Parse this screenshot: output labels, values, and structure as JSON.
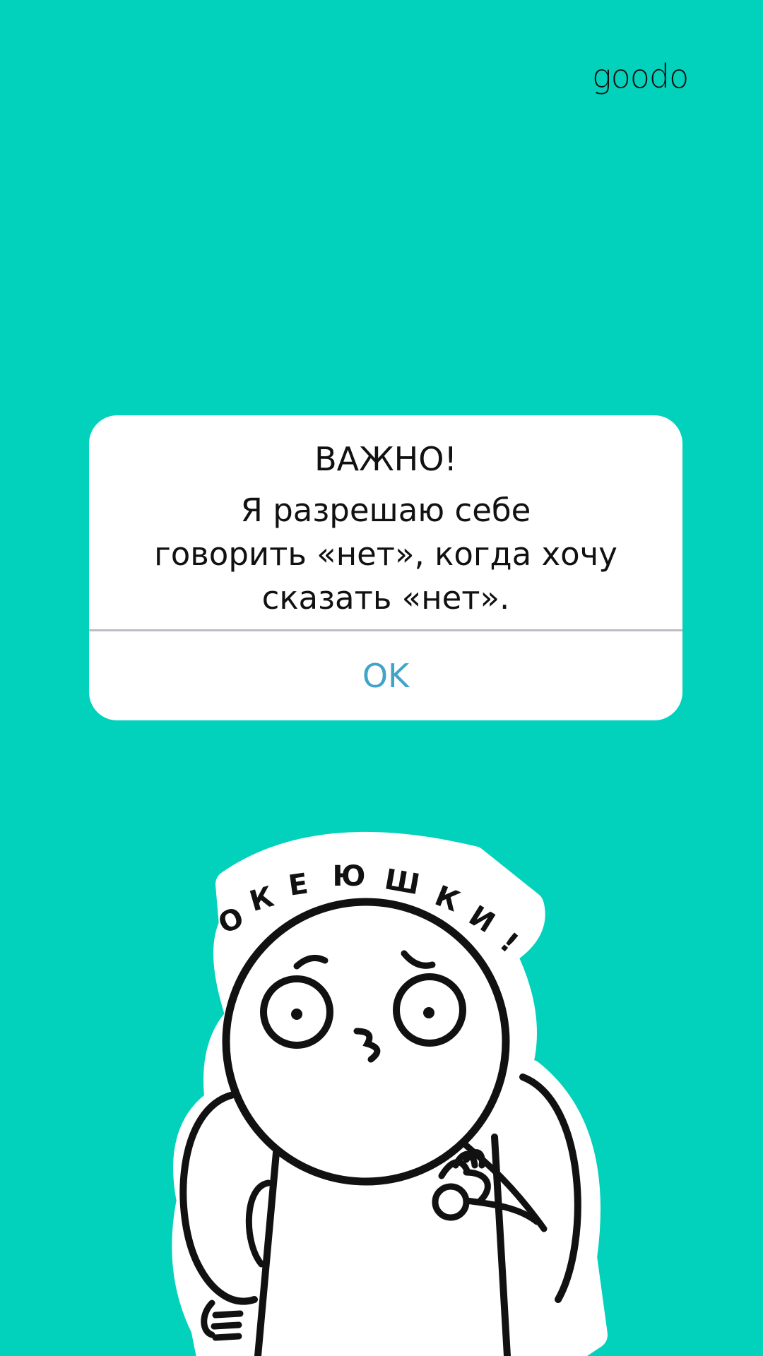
{
  "brand": {
    "logo_text": "goodo"
  },
  "alert": {
    "title": "ВАЖНО!",
    "message": "Я разрешаю себе\nговорить «нет», когда хочу\nсказать «нет».",
    "button_label": "OK"
  },
  "sticker": {
    "caption_letters": [
      "О",
      "К",
      "Е",
      "Ю",
      "Ш",
      "К",
      "И",
      "!"
    ]
  },
  "colors": {
    "background": "#02D1BC",
    "dialog": "#FFFFFF",
    "button_text": "#3FA4C8",
    "divider": "#BCBCC4",
    "text": "#111111"
  }
}
